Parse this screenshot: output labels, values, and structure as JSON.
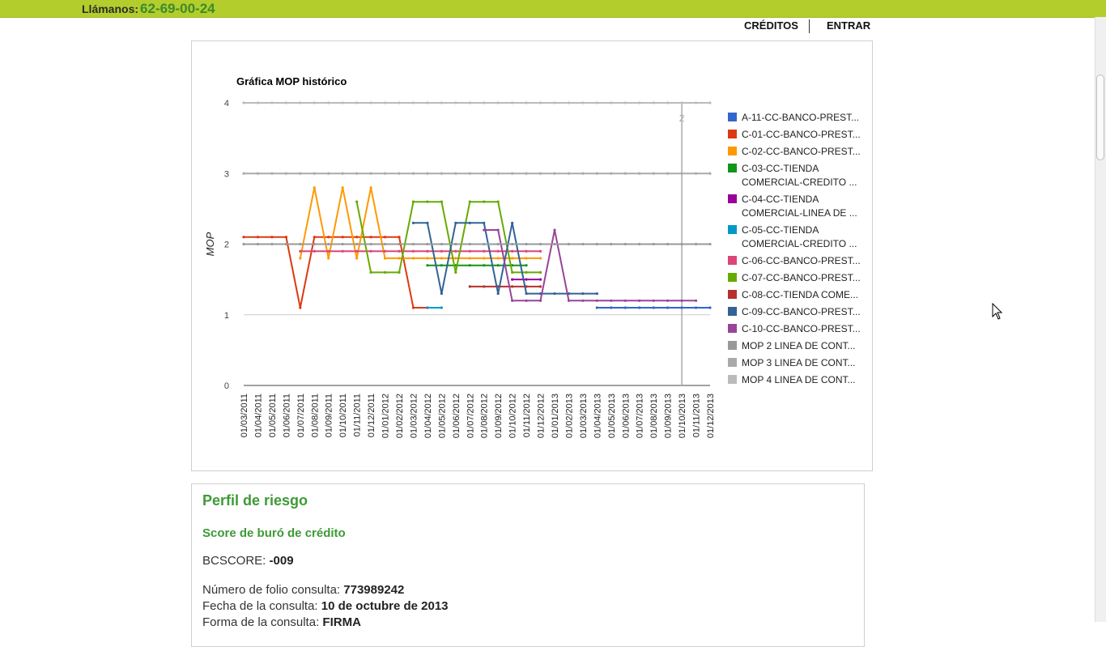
{
  "header": {
    "phone_label": "Llámanos:",
    "phone_number": "62-69-00-24",
    "nav": [
      "CRÉDITOS",
      "ENTRAR"
    ]
  },
  "chart_data": {
    "type": "line",
    "title": "Gráfica MOP histórico",
    "ylabel": "MOP",
    "xlabel": "",
    "ylim": [
      0,
      4
    ],
    "yticks": [
      0,
      1,
      2,
      3,
      4
    ],
    "grid": true,
    "legend_position": "right",
    "categories": [
      "01/03/2011",
      "01/04/2011",
      "01/05/2011",
      "01/06/2011",
      "01/07/2011",
      "01/08/2011",
      "01/09/2011",
      "01/10/2011",
      "01/11/2011",
      "01/12/2011",
      "01/01/2012",
      "01/02/2012",
      "01/03/2012",
      "01/04/2012",
      "01/05/2012",
      "01/06/2012",
      "01/07/2012",
      "01/08/2012",
      "01/09/2012",
      "01/10/2012",
      "01/11/2012",
      "01/12/2012",
      "01/01/2013",
      "01/02/2013",
      "01/03/2013",
      "01/04/2013",
      "01/05/2013",
      "01/06/2013",
      "01/07/2013",
      "01/08/2013",
      "01/09/2013",
      "01/10/2013",
      "01/11/2013",
      "01/12/2013"
    ],
    "annotation": {
      "category": "01/10/2013",
      "text": "2"
    },
    "series": [
      {
        "name": "A-11-CC-BANCO-PREST...",
        "color": "#3366cc",
        "start": 25,
        "values": [
          1.1,
          1.1,
          1.1,
          1.1,
          1.1,
          1.1,
          1.1,
          1.1,
          1.1
        ],
        "dashed_tail": true
      },
      {
        "name": "C-01-CC-BANCO-PREST...",
        "color": "#dc3912",
        "start": 0,
        "values": [
          2.1,
          2.1,
          2.1,
          2.1,
          1.1,
          2.1,
          2.1,
          2.1,
          2.1,
          2.1,
          2.1,
          2.1,
          1.1,
          1.1
        ]
      },
      {
        "name": "C-02-CC-BANCO-PREST...",
        "color": "#ff9900",
        "start": 4,
        "values": [
          1.8,
          2.8,
          1.8,
          2.8,
          1.8,
          2.8,
          1.8,
          1.8,
          1.8,
          1.8,
          1.8,
          1.8,
          1.8,
          1.8,
          1.8,
          1.8,
          1.8,
          1.8
        ]
      },
      {
        "name": "C-03-CC-TIENDA COMERCIAL-CREDITO ...",
        "color": "#109618",
        "start": 13,
        "values": [
          1.7,
          1.7,
          1.7,
          1.7,
          1.7,
          1.7,
          1.7,
          1.7
        ]
      },
      {
        "name": "C-04-CC-TIENDA COMERCIAL-LINEA DE ...",
        "color": "#990099",
        "start": 19,
        "values": [
          1.5,
          1.5,
          1.5
        ]
      },
      {
        "name": "C-05-CC-TIENDA COMERCIAL-CREDITO ...",
        "color": "#0099c6",
        "start": 13,
        "values": [
          1.1,
          1.1
        ]
      },
      {
        "name": "C-06-CC-BANCO-PREST...",
        "color": "#dd4477",
        "start": 4,
        "values": [
          1.9,
          1.9,
          1.9,
          1.9,
          1.9,
          1.9,
          1.9,
          1.9,
          1.9,
          1.9,
          1.9,
          1.9,
          1.9,
          1.9,
          1.9,
          1.9,
          1.9,
          1.9
        ]
      },
      {
        "name": "C-07-CC-BANCO-PREST...",
        "color": "#66aa00",
        "start": 8,
        "values": [
          2.6,
          1.6,
          1.6,
          1.6,
          2.6,
          2.6,
          2.6,
          1.6,
          2.6,
          2.6,
          2.6,
          1.6,
          1.6,
          1.6
        ]
      },
      {
        "name": "C-08-CC-TIENDA COME...",
        "color": "#b82e2e",
        "start": 16,
        "values": [
          1.4,
          1.4,
          1.4,
          1.4,
          1.4,
          1.4
        ]
      },
      {
        "name": "C-09-CC-BANCO-PREST...",
        "color": "#316395",
        "start": 12,
        "values": [
          2.3,
          2.3,
          1.3,
          2.3,
          2.3,
          2.3,
          1.3,
          2.3,
          1.3,
          1.3,
          1.3,
          1.3,
          1.3,
          1.3
        ]
      },
      {
        "name": "C-10-CC-BANCO-PREST...",
        "color": "#994499",
        "start": 17,
        "values": [
          2.2,
          2.2,
          1.2,
          1.2,
          1.2,
          2.2,
          1.2,
          1.2,
          1.2,
          1.2,
          1.2,
          1.2,
          1.2,
          1.2,
          1.2,
          1.2
        ]
      },
      {
        "name": "MOP 2 LINEA DE CONT...",
        "color": "#999999",
        "start": 0,
        "constant": 2
      },
      {
        "name": "MOP 3 LINEA DE CONT...",
        "color": "#aaaaaa",
        "start": 0,
        "constant": 3
      },
      {
        "name": "MOP 4 LINEA DE CONT...",
        "color": "#bbbbbb",
        "start": 0,
        "constant": 4
      }
    ]
  },
  "profile": {
    "title": "Perfil de riesgo",
    "score_title": "Score de buró de crédito",
    "bcscore_label": "BCSCORE: ",
    "bcscore_value": "-009",
    "folio_label": "Número de folio consulta: ",
    "folio_value": "773989242",
    "date_label": "Fecha de la consulta: ",
    "date_value": "10 de octubre de 2013",
    "form_label": "Forma de la consulta: ",
    "form_value": "FIRMA"
  }
}
